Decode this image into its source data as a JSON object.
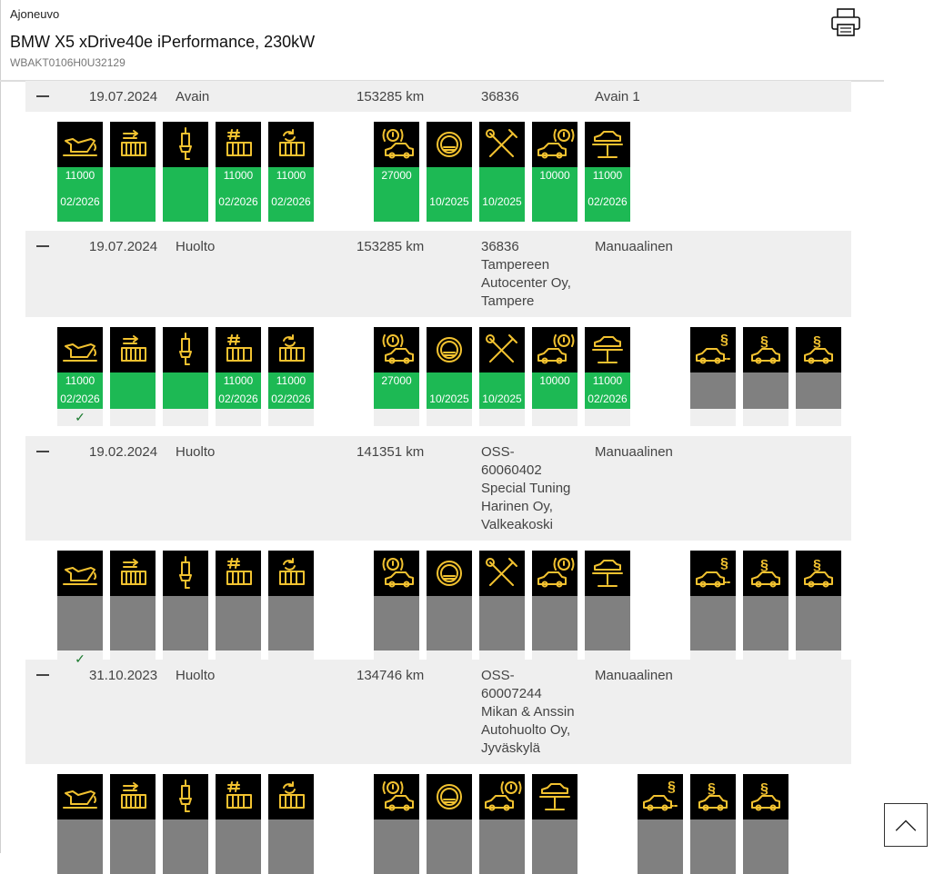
{
  "header": {
    "label": "Ajoneuvo",
    "title": "BMW X5 xDrive40e iPerformance, 230kW",
    "vin": "WBAKT0106H0U32129"
  },
  "entries": [
    {
      "date": "19.07.2024",
      "type": "Avain",
      "km": "153285 km",
      "details": [
        "36836"
      ],
      "source": "Avain 1"
    },
    {
      "date": "19.07.2024",
      "type": "Huolto",
      "km": "153285 km",
      "details": [
        "36836",
        "Tampereen",
        "Autocenter Oy,",
        "Tampere"
      ],
      "source": "Manuaalinen"
    },
    {
      "date": "19.02.2024",
      "type": "Huolto",
      "km": "141351 km",
      "details": [
        "OSS-",
        "60060402",
        "Special Tuning",
        "Harinen Oy,",
        "Valkeakoski"
      ],
      "source": "Manuaalinen"
    },
    {
      "date": "31.10.2023",
      "type": "Huolto",
      "km": "134746 km",
      "details": [
        "OSS-",
        "60007244",
        "Mikan & Anssin",
        "Autohuolto Oy,",
        "Jyväskylä"
      ],
      "source": "Manuaalinen"
    }
  ],
  "groups": [
    {
      "tiles": [
        {
          "icon": "engine-oil-icon",
          "status": "green",
          "values": [
            "11000",
            "02/2026"
          ]
        },
        {
          "icon": "microfilter-icon",
          "status": "green",
          "values": [
            "",
            ""
          ]
        },
        {
          "icon": "spark-plug-icon",
          "status": "green",
          "values": [
            "",
            ""
          ]
        },
        {
          "icon": "fuel-filter-icon",
          "status": "green",
          "values": [
            "11000",
            "02/2026"
          ]
        },
        {
          "icon": "air-filter-icon",
          "status": "green",
          "values": [
            "11000",
            "02/2026"
          ]
        },
        {
          "icon": "front-brake-icon",
          "status": "green",
          "values": [
            "27000",
            ""
          ]
        },
        {
          "icon": "brake-fluid-icon",
          "status": "green",
          "values": [
            "",
            "10/2025"
          ]
        },
        {
          "icon": "vehicle-check-icon",
          "status": "green",
          "values": [
            "",
            "10/2025"
          ]
        },
        {
          "icon": "rear-brake-icon",
          "status": "green",
          "values": [
            "10000",
            ""
          ]
        },
        {
          "icon": "vehicle-lift-icon",
          "status": "green",
          "values": [
            "11000",
            "02/2026"
          ]
        }
      ]
    },
    {
      "tiles": [
        {
          "icon": "engine-oil-icon",
          "status": "green",
          "values": [
            "11000",
            "02/2026"
          ],
          "check": "✓"
        },
        {
          "icon": "microfilter-icon",
          "status": "green",
          "values": [
            "",
            ""
          ],
          "check": ""
        },
        {
          "icon": "spark-plug-icon",
          "status": "green",
          "values": [
            "",
            ""
          ],
          "check": ""
        },
        {
          "icon": "fuel-filter-icon",
          "status": "green",
          "values": [
            "11000",
            "02/2026"
          ],
          "check": ""
        },
        {
          "icon": "air-filter-icon",
          "status": "green",
          "values": [
            "11000",
            "02/2026"
          ],
          "check": ""
        },
        {
          "icon": "front-brake-icon",
          "status": "green",
          "values": [
            "27000",
            ""
          ],
          "check": ""
        },
        {
          "icon": "brake-fluid-icon",
          "status": "green",
          "values": [
            "",
            "10/2025"
          ],
          "check": ""
        },
        {
          "icon": "vehicle-check-icon",
          "status": "green",
          "values": [
            "",
            "10/2025"
          ],
          "check": ""
        },
        {
          "icon": "rear-brake-icon",
          "status": "green",
          "values": [
            "10000",
            ""
          ],
          "check": ""
        },
        {
          "icon": "vehicle-lift-icon",
          "status": "green",
          "values": [
            "11000",
            "02/2026"
          ],
          "check": ""
        },
        {
          "icon": "exhaust-inspection-icon",
          "status": "grey",
          "values": [
            "",
            ""
          ],
          "check": ""
        },
        {
          "icon": "vehicle-inspection-icon",
          "status": "grey",
          "values": [
            "",
            ""
          ],
          "check": ""
        },
        {
          "icon": "vehicle-inspection-icon",
          "status": "grey",
          "values": [
            "",
            ""
          ],
          "check": ""
        }
      ]
    },
    {
      "tiles": [
        {
          "icon": "engine-oil-icon",
          "status": "grey",
          "values": [
            "",
            ""
          ],
          "check": "✓"
        },
        {
          "icon": "microfilter-icon",
          "status": "grey",
          "values": [
            "",
            ""
          ],
          "check": ""
        },
        {
          "icon": "spark-plug-icon",
          "status": "grey",
          "values": [
            "",
            ""
          ],
          "check": ""
        },
        {
          "icon": "fuel-filter-icon",
          "status": "grey",
          "values": [
            "",
            ""
          ],
          "check": ""
        },
        {
          "icon": "air-filter-icon",
          "status": "grey",
          "values": [
            "",
            ""
          ],
          "check": ""
        },
        {
          "icon": "front-brake-icon",
          "status": "grey",
          "values": [
            "",
            ""
          ],
          "check": ""
        },
        {
          "icon": "brake-fluid-icon",
          "status": "grey",
          "values": [
            "",
            ""
          ],
          "check": ""
        },
        {
          "icon": "vehicle-check-icon",
          "status": "grey",
          "values": [
            "",
            ""
          ],
          "check": ""
        },
        {
          "icon": "rear-brake-icon",
          "status": "grey",
          "values": [
            "",
            ""
          ],
          "check": ""
        },
        {
          "icon": "vehicle-lift-icon",
          "status": "grey",
          "values": [
            "",
            ""
          ],
          "check": ""
        },
        {
          "icon": "exhaust-inspection-icon",
          "status": "grey",
          "values": [
            "",
            ""
          ],
          "check": ""
        },
        {
          "icon": "vehicle-inspection-icon",
          "status": "grey",
          "values": [
            "",
            ""
          ],
          "check": ""
        },
        {
          "icon": "vehicle-inspection-icon",
          "status": "grey",
          "values": [
            "",
            ""
          ],
          "check": ""
        }
      ]
    },
    {
      "tiles": [
        {
          "icon": "engine-oil-icon",
          "status": "grey",
          "values": [
            "",
            ""
          ]
        },
        {
          "icon": "microfilter-icon",
          "status": "grey",
          "values": [
            "",
            ""
          ]
        },
        {
          "icon": "spark-plug-icon",
          "status": "grey",
          "values": [
            "",
            ""
          ]
        },
        {
          "icon": "fuel-filter-icon",
          "status": "grey",
          "values": [
            "",
            ""
          ]
        },
        {
          "icon": "air-filter-icon",
          "status": "grey",
          "values": [
            "",
            ""
          ]
        },
        {
          "icon": "front-brake-icon",
          "status": "grey",
          "values": [
            "",
            ""
          ]
        },
        {
          "icon": "brake-fluid-icon",
          "status": "grey",
          "values": [
            "",
            ""
          ]
        },
        {
          "icon": "rear-brake-icon",
          "status": "grey",
          "values": [
            "",
            ""
          ]
        },
        {
          "icon": "vehicle-lift-icon",
          "status": "grey",
          "values": [
            "",
            ""
          ]
        },
        {
          "icon": "exhaust-inspection-icon",
          "status": "grey",
          "values": [
            "",
            ""
          ]
        },
        {
          "icon": "vehicle-inspection-icon",
          "status": "grey",
          "values": [
            "",
            ""
          ]
        },
        {
          "icon": "vehicle-inspection-icon",
          "status": "grey",
          "values": [
            "",
            ""
          ]
        }
      ]
    }
  ],
  "colors": {
    "icon_yellow": "#f2c230",
    "status_green": "#1db954",
    "status_grey": "#808080"
  },
  "scroll_top": {
    "icon": "chevron-up-icon"
  }
}
